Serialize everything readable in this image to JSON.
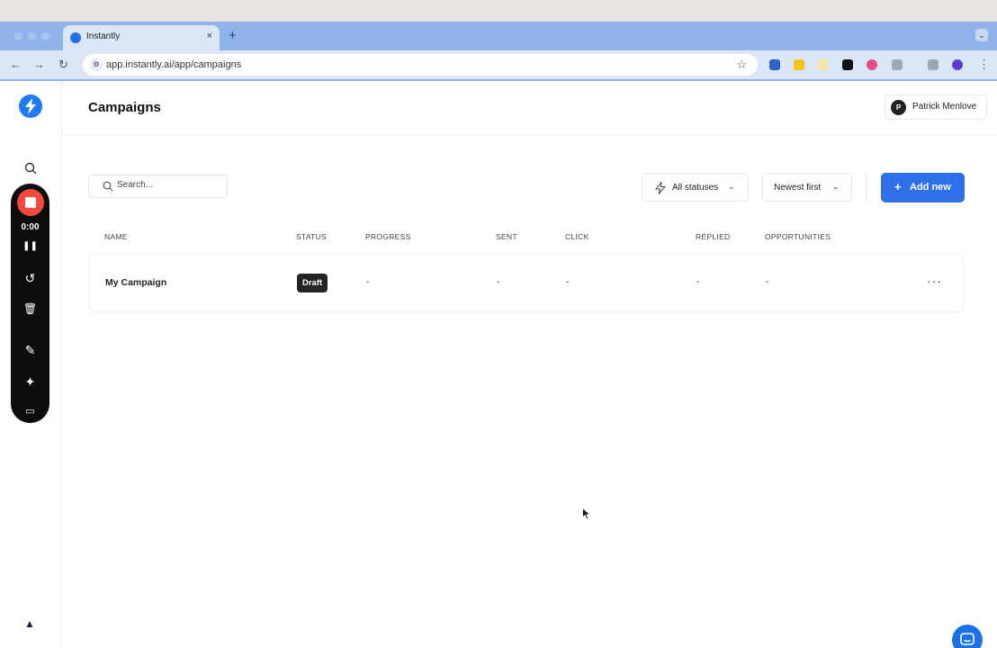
{
  "browser": {
    "tab_title": "Instantly",
    "tab_close": "×",
    "new_tab": "+",
    "url": "app.instantly.ai/app/campaigns",
    "back": "←",
    "forward": "→",
    "reload": "↻",
    "star": "☆",
    "tab_menu": "⌄",
    "extensions": [
      {
        "name": "ext-blue-icon",
        "color": "#2a62c9"
      },
      {
        "name": "ext-yellow-icon",
        "color": "#f5c518"
      },
      {
        "name": "ext-folder-icon",
        "color": "#f3e6a8"
      },
      {
        "name": "ext-black-icon",
        "color": "#111111"
      },
      {
        "name": "ext-color-wheel-icon",
        "color": "#e94b8a"
      },
      {
        "name": "ext-puzzle-icon",
        "color": "#9aa6b8"
      },
      {
        "name": "ext-sidepanel-icon",
        "color": "#9aa6b8"
      },
      {
        "name": "ext-profile-icon",
        "color": "#5b3fd1"
      }
    ]
  },
  "recorder": {
    "time": "0:00",
    "pause_glyph": "❚❚",
    "undo_glyph": "↺",
    "trash_glyph": "🗑",
    "pen_glyph": "✎",
    "magic_glyph": "✦",
    "camera_glyph": "▭"
  },
  "header": {
    "title": "Campaigns",
    "user_initial": "P",
    "user_name": "Patrick Menlove"
  },
  "filters": {
    "search_placeholder": "Search...",
    "status_filter": "All statuses",
    "sort": "Newest first",
    "add_new": "Add new",
    "add_plus": "+",
    "chevron": "⌄"
  },
  "table": {
    "columns": [
      "NAME",
      "STATUS",
      "PROGRESS",
      "SENT",
      "CLICK",
      "REPLIED",
      "OPPORTUNITIES"
    ],
    "rows": [
      {
        "name": "My Campaign",
        "status": "Draft",
        "progress": "-",
        "sent": "-",
        "click": "-",
        "replied": "-",
        "opportunities": "-",
        "more": "···"
      }
    ]
  },
  "colors": {
    "accent": "#2f6fe8",
    "record": "#f04a3e",
    "browser_chrome": "#8fb3ea"
  }
}
